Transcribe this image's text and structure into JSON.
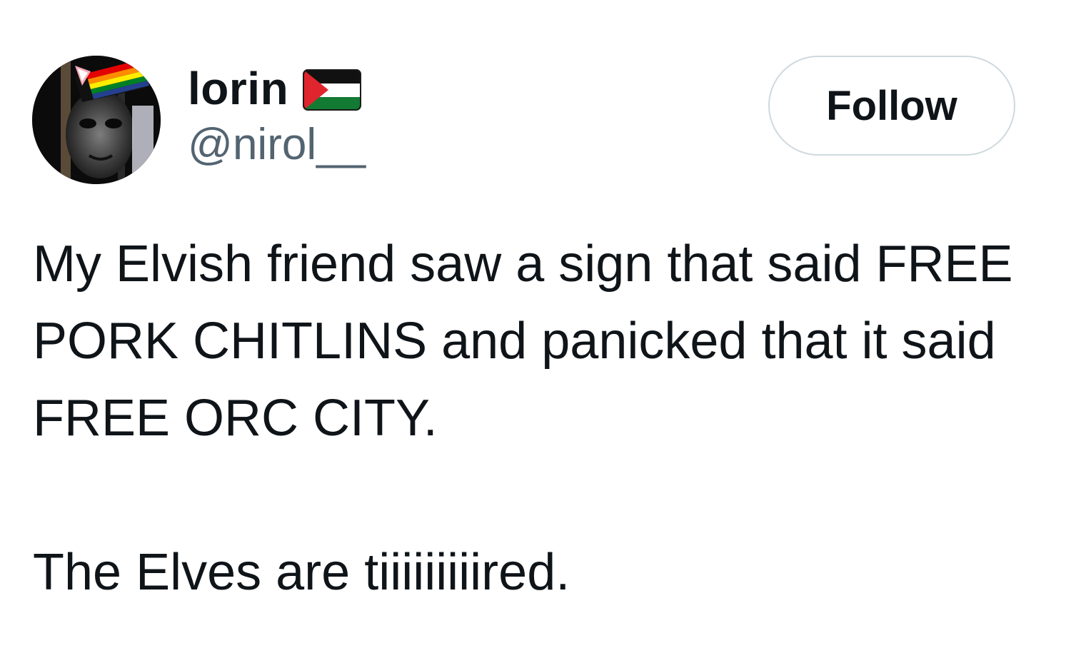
{
  "user": {
    "display_name": "lorin",
    "handle": "@nirol__",
    "flag_icon": "palestine-flag-icon",
    "avatar_icon": "profile-avatar"
  },
  "follow_button": {
    "label": "Follow"
  },
  "tweet": {
    "paragraph1": [
      "My Elvish friend saw a sign that said FREE",
      "PORK CHITLINS and panicked that it said",
      "FREE ORC CITY."
    ],
    "paragraph2": "The Elves are tiiiiiiiiired."
  },
  "colors": {
    "text_primary": "#0f1419",
    "text_secondary": "#536471",
    "button_border": "#cfd9de",
    "flag_red": "#e0252e",
    "flag_black": "#111111",
    "flag_white": "#ffffff",
    "flag_green": "#137a33"
  }
}
